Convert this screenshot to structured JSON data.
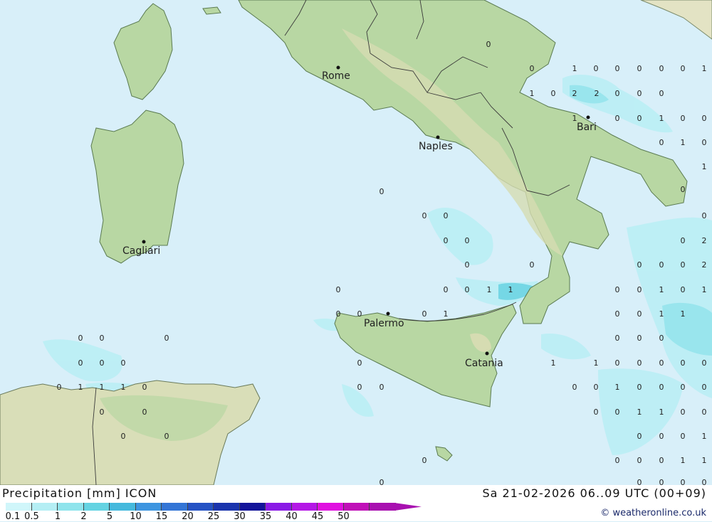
{
  "header": {
    "title": "Precipitation [mm] ICON",
    "datetime": "Sa 21-02-2026 06..09 UTC (00+09)",
    "credit": "© weatheronline.co.uk"
  },
  "cities": [
    {
      "name": "Rome"
    },
    {
      "name": "Naples"
    },
    {
      "name": "Bari"
    },
    {
      "name": "Cagliari"
    },
    {
      "name": "Palermo"
    },
    {
      "name": "Catania"
    }
  ],
  "legend": {
    "labels": [
      "0.1",
      "0.5",
      "1",
      "2",
      "5",
      "10",
      "15",
      "20",
      "25",
      "30",
      "35",
      "40",
      "45",
      "50"
    ],
    "colors": [
      "#d0f6fa",
      "#b4eef4",
      "#8fe4ec",
      "#64d3e2",
      "#45b9dd",
      "#3d95e0",
      "#3375d6",
      "#2552c4",
      "#1a34ad",
      "#13149a",
      "#8a1ae6",
      "#b417e6",
      "#e010e0",
      "#c010b8",
      "#a810b0"
    ]
  },
  "values": [
    "0",
    "1",
    "2",
    "2",
    "0",
    "0",
    "0",
    "0",
    "0",
    "1",
    "0",
    "0",
    "0",
    "0",
    "0",
    "0",
    "0",
    "0",
    "0",
    "0",
    "2",
    "0",
    "0",
    "0",
    "0",
    "0",
    "2",
    "0",
    "0",
    "0",
    "1",
    "1",
    "0",
    "0",
    "1",
    "0",
    "1",
    "0",
    "0",
    "0",
    "1",
    "0",
    "0",
    "1",
    "1",
    "0",
    "0",
    "0",
    "0",
    "0",
    "0",
    "0",
    "0",
    "0",
    "0",
    "1",
    "1",
    "0",
    "0",
    "0",
    "0",
    "0",
    "0",
    "1",
    "1",
    "1",
    "0",
    "0",
    "0",
    "0",
    "0",
    "1",
    "0",
    "0",
    "0",
    "0",
    "0",
    "0",
    "0",
    "0",
    "1",
    "1",
    "0",
    "0",
    "0",
    "0",
    "0",
    "0",
    "0",
    "1",
    "0",
    "0",
    "0",
    "0",
    "1",
    "1",
    "0",
    "0",
    "0",
    "0",
    "0",
    "1",
    "0",
    "1",
    "0",
    "1",
    "0",
    "1",
    "1",
    "0",
    "0",
    "0",
    "0",
    "0",
    "0",
    "0",
    "0"
  ],
  "colors": {
    "sea": "#d8eff9",
    "land": "#b5d4a0",
    "hills": "#cfd9b0",
    "africa_land": "#d9deb8",
    "rain_light": "#b4eef4",
    "rain_medium": "#8fe4ec",
    "border": "#3a3a3a"
  },
  "icons": [
    "city-dot"
  ]
}
